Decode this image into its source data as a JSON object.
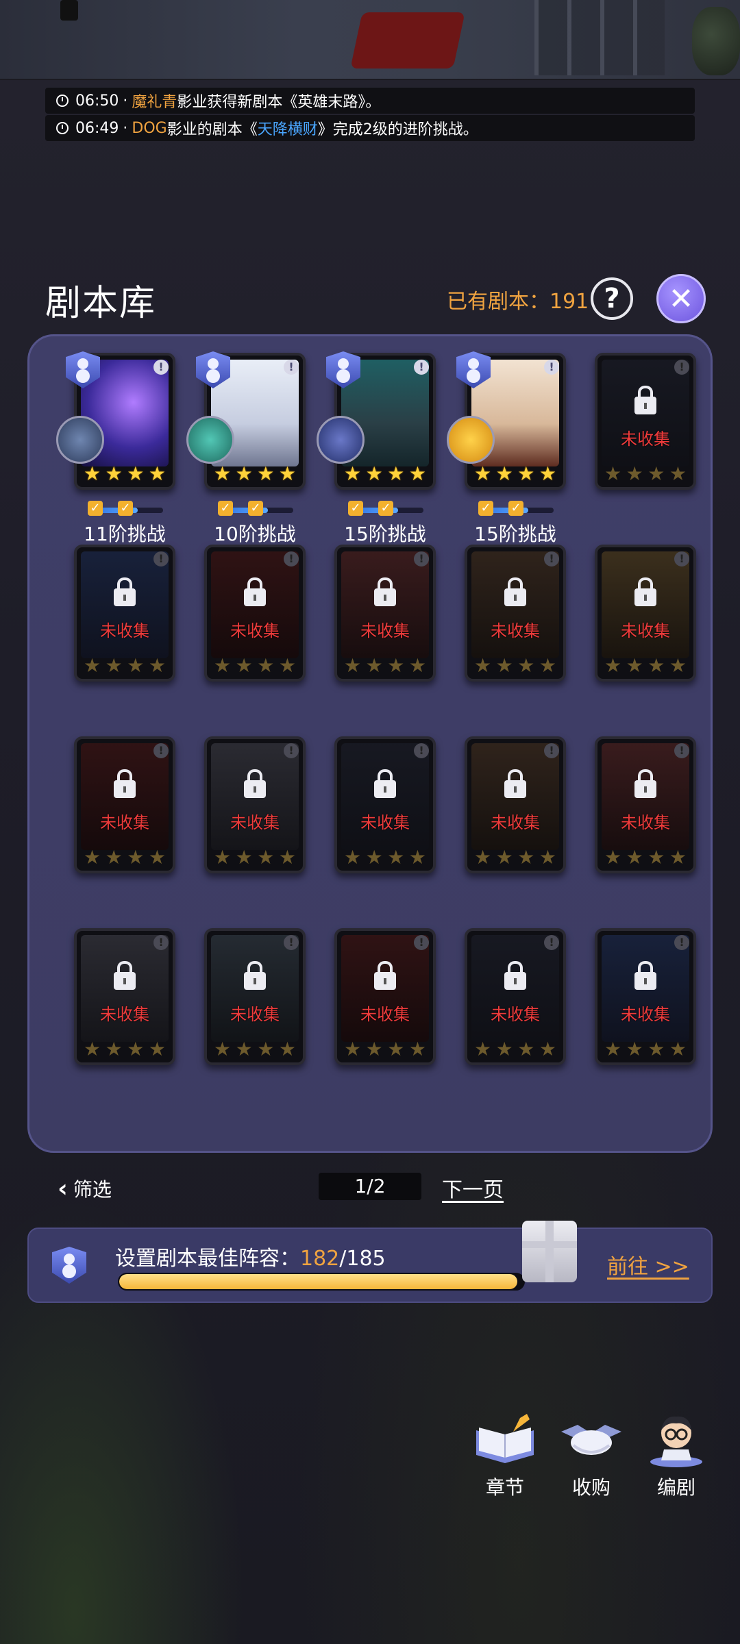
{
  "news": [
    {
      "time": "06:50",
      "sep": "·",
      "name": "魔礼青",
      "text1": "影业获得新剧本《英雄末路》。",
      "highlight": "",
      "text2": ""
    },
    {
      "time": "06:49",
      "sep": "·",
      "name": "DOG",
      "text1": "影业的剧本《",
      "highlight": "天降横财",
      "text2": "》完成2级的进阶挑战。"
    }
  ],
  "header": {
    "title": "剧本库",
    "count_label": "已有剧本：191",
    "help_symbol": "?",
    "close_symbol": "✕"
  },
  "cards": [
    {
      "collected": true,
      "stars": 4,
      "info": "!",
      "challenge": "11阶挑战",
      "theme": "galaxy",
      "badge": "ufo"
    },
    {
      "collected": true,
      "stars": 4,
      "info": "!",
      "challenge": "10阶挑战",
      "theme": "swordsman",
      "badge": "ninja"
    },
    {
      "collected": true,
      "stars": 4,
      "info": "!",
      "challenge": "15阶挑战",
      "theme": "hero",
      "badge": "ship"
    },
    {
      "collected": true,
      "stars": 4,
      "info": "!",
      "challenge": "15阶挑战",
      "theme": "lady",
      "badge": "soldier"
    },
    {
      "collected": false,
      "stars": 4,
      "info": "!",
      "label": "未收集",
      "theme": "dark"
    },
    {
      "collected": false,
      "stars": 4,
      "info": "!",
      "label": "未收集",
      "theme": "blue"
    },
    {
      "collected": false,
      "stars": 4,
      "info": "!",
      "label": "未收集",
      "theme": "red"
    },
    {
      "collected": false,
      "stars": 4,
      "info": "!",
      "label": "未收集",
      "theme": "crimson"
    },
    {
      "collected": false,
      "stars": 4,
      "info": "!",
      "label": "未收集",
      "theme": "brown"
    },
    {
      "collected": false,
      "stars": 4,
      "info": "!",
      "label": "未收集",
      "theme": "amber"
    },
    {
      "collected": false,
      "stars": 4,
      "info": "!",
      "label": "未收集",
      "theme": "red"
    },
    {
      "collected": false,
      "stars": 4,
      "info": "!",
      "label": "未收集",
      "theme": "grey"
    },
    {
      "collected": false,
      "stars": 4,
      "info": "!",
      "label": "未收集",
      "theme": "dark"
    },
    {
      "collected": false,
      "stars": 4,
      "info": "!",
      "label": "未收集",
      "theme": "brown"
    },
    {
      "collected": false,
      "stars": 4,
      "info": "!",
      "label": "未收集",
      "theme": "crimson"
    },
    {
      "collected": false,
      "stars": 4,
      "info": "!",
      "label": "未收集",
      "theme": "grey"
    },
    {
      "collected": false,
      "stars": 4,
      "info": "!",
      "label": "未收集",
      "theme": "slate"
    },
    {
      "collected": false,
      "stars": 4,
      "info": "!",
      "label": "未收集",
      "theme": "red"
    },
    {
      "collected": false,
      "stars": 4,
      "info": "!",
      "label": "未收集",
      "theme": "dark"
    },
    {
      "collected": false,
      "stars": 4,
      "info": "!",
      "label": "未收集",
      "theme": "blue"
    }
  ],
  "challenge_progress": [
    0.66,
    0.66,
    0.66,
    0.66
  ],
  "pager": {
    "filter_label": "筛选",
    "page": "1/2",
    "next_label": "下一页"
  },
  "lineup": {
    "label": "设置剧本最佳阵容：",
    "current": "182",
    "total": "/185",
    "progress": 0.984,
    "go_label": "前往 >>"
  },
  "dock": [
    {
      "label": "章节",
      "icon": "book-icon"
    },
    {
      "label": "收购",
      "icon": "handshake-icon"
    },
    {
      "label": "编剧",
      "icon": "writer-icon"
    }
  ],
  "colors": {
    "accent_orange": "#f0a340",
    "highlight_blue": "#4aa6ff",
    "uncollected_red": "#ef3b3b",
    "panel": "#3f3e68",
    "star": "#ffd23a"
  }
}
